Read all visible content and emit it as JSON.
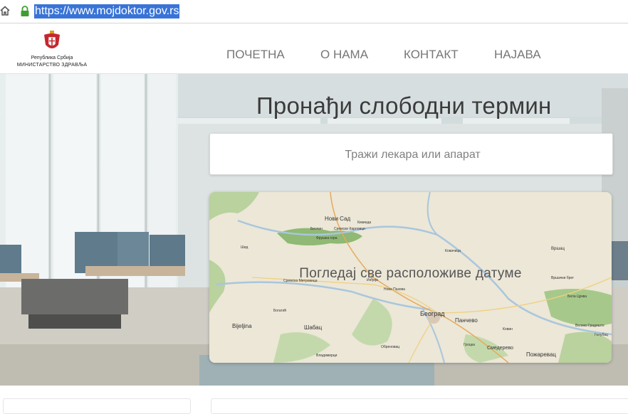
{
  "browser": {
    "url": "https://www.mojdoktor.gov.rs",
    "home_icon": "home-icon",
    "lock_icon": "lock-icon"
  },
  "header": {
    "logo_line1": "Република Србија",
    "logo_line2": "МИНИСТАРСТВО ЗДРАВЉА",
    "coat_icon": "coat-of-arms-icon"
  },
  "nav": {
    "items": [
      {
        "label": "ПОЧЕТНА"
      },
      {
        "label": "О НАМА"
      },
      {
        "label": "КОНТАКТ"
      },
      {
        "label": "НАЈАВА"
      }
    ]
  },
  "hero": {
    "title": "Пронађи слободни термин",
    "search_placeholder": "Тражи лекара или апарат",
    "map_overlay": "Погледај све расположиве датуме"
  },
  "map": {
    "place_labels": [
      "Нови Сад",
      "Кикинда",
      "Беочин",
      "Сремски Карловци",
      "Фрушка гора",
      "Шид",
      "Ковачица",
      "Вршац",
      "Сремска Митровица",
      "Инђија",
      "Нова Пазова",
      "Бела Црква",
      "Богатић",
      "Београд",
      "Панчево",
      "Велико Градиште",
      "Bijeljina",
      "Шабац",
      "Обреновац",
      "Ковин",
      "Гроцка",
      "Смедерево",
      "Пожаревац",
      "Владимирци",
      "Голубац",
      "Вршачки брег"
    ]
  },
  "colors": {
    "url_highlight": "#3874d8",
    "nav_text": "#777777",
    "title_text": "#3b3b3b",
    "map_land": "#ece7d7",
    "map_forest": "#a6c98b"
  }
}
